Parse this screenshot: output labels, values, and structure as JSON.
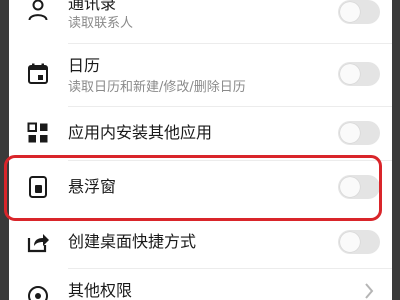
{
  "permissions": [
    {
      "title": "通讯录",
      "subtitle": "读取联系人",
      "icon": "person-icon",
      "control": "toggle",
      "enabled": false
    },
    {
      "title": "日历",
      "subtitle": "读取日历和新建/修改/删除日历",
      "icon": "calendar-icon",
      "control": "toggle",
      "enabled": false
    },
    {
      "title": "应用内安装其他应用",
      "subtitle": "",
      "icon": "apps-grid-icon",
      "control": "toggle",
      "enabled": false
    },
    {
      "title": "悬浮窗",
      "subtitle": "",
      "icon": "floating-window-icon",
      "control": "toggle",
      "enabled": false,
      "highlighted": true
    },
    {
      "title": "创建桌面快捷方式",
      "subtitle": "",
      "icon": "share-arrow-icon",
      "control": "toggle",
      "enabled": false
    },
    {
      "title": "其他权限",
      "subtitle": "",
      "icon": "settings-icon",
      "control": "chevron"
    }
  ],
  "colors": {
    "highlight_border": "#d9252a",
    "toggle_off_track": "#e4e4e4",
    "subtitle_text": "#8a8a8a",
    "frame": "#3a3a3a"
  }
}
